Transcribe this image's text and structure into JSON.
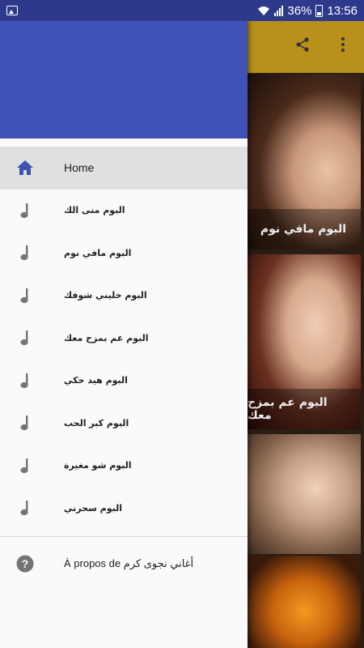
{
  "status_bar": {
    "wifi_icon": "wifi-icon",
    "battery_percent": "36%",
    "time": "13:56"
  },
  "background_app": {
    "toolbar": {
      "share_icon": "share-icon",
      "more_icon": "more-vert-icon",
      "color": "#b8901a"
    },
    "albums": [
      {
        "caption": "البوم مافي نوم"
      },
      {
        "caption": "البوم عم بمزح معك"
      },
      {
        "caption": ""
      },
      {
        "caption": ""
      }
    ]
  },
  "drawer": {
    "header_color": "#3f51b5",
    "items": [
      {
        "label": "Home",
        "icon": "home-icon",
        "active": true
      },
      {
        "label": "البوم منى الك",
        "icon": "music-note-icon"
      },
      {
        "label": "البوم مافي نوم",
        "icon": "music-note-icon"
      },
      {
        "label": "البوم خليني شوفك",
        "icon": "music-note-icon"
      },
      {
        "label": "البوم عم بمزح معك",
        "icon": "music-note-icon"
      },
      {
        "label": "البوم هيد حكي",
        "icon": "music-note-icon"
      },
      {
        "label": "البوم كبر الحب",
        "icon": "music-note-icon"
      },
      {
        "label": "البوم شو مغيرة",
        "icon": "music-note-icon"
      },
      {
        "label": "البوم سحرني",
        "icon": "music-note-icon"
      }
    ],
    "about": {
      "label": "À propos de أغاني نجوى كرم",
      "icon": "help-icon"
    }
  }
}
